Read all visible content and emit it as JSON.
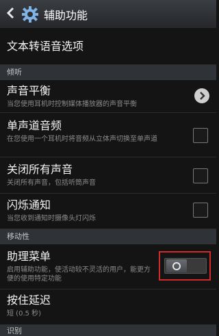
{
  "header": {
    "title": "辅助功能"
  },
  "rows": {
    "tts": {
      "title": "文本转语音选项"
    },
    "balance": {
      "title": "声音平衡",
      "sub": "当您使用耳机时控制媒体播放器的声音平衡"
    },
    "mono": {
      "title": "单声道音频",
      "sub": "在您使用一个耳机时将音频从立体声切换至单声道",
      "checked": false
    },
    "mute_all": {
      "title": "关闭所有声音",
      "sub": "关闭所有声音，包括听筒声音",
      "checked": false
    },
    "flash": {
      "title": "闪烁通知",
      "sub": "当您收到通知时摄像头灯闪烁",
      "checked": false
    },
    "assist_menu": {
      "title": "助理菜单",
      "sub": "启用辅助功能，使活动较不灵活的用户，能更方便的使用特定功能",
      "toggle": "off"
    },
    "hold_delay": {
      "title": "按住延迟",
      "sub": "短 (0.5 秒)"
    }
  },
  "sections": {
    "hearing": "倾听",
    "mobility": "移动性",
    "recognition": "识别"
  },
  "icons": {
    "back": "chevron-left-icon",
    "settings": "gear-icon",
    "balance_arrow": "chevron-right-icon"
  },
  "colors": {
    "highlight": "#d42a2a",
    "section_bg": "#2f3236"
  }
}
